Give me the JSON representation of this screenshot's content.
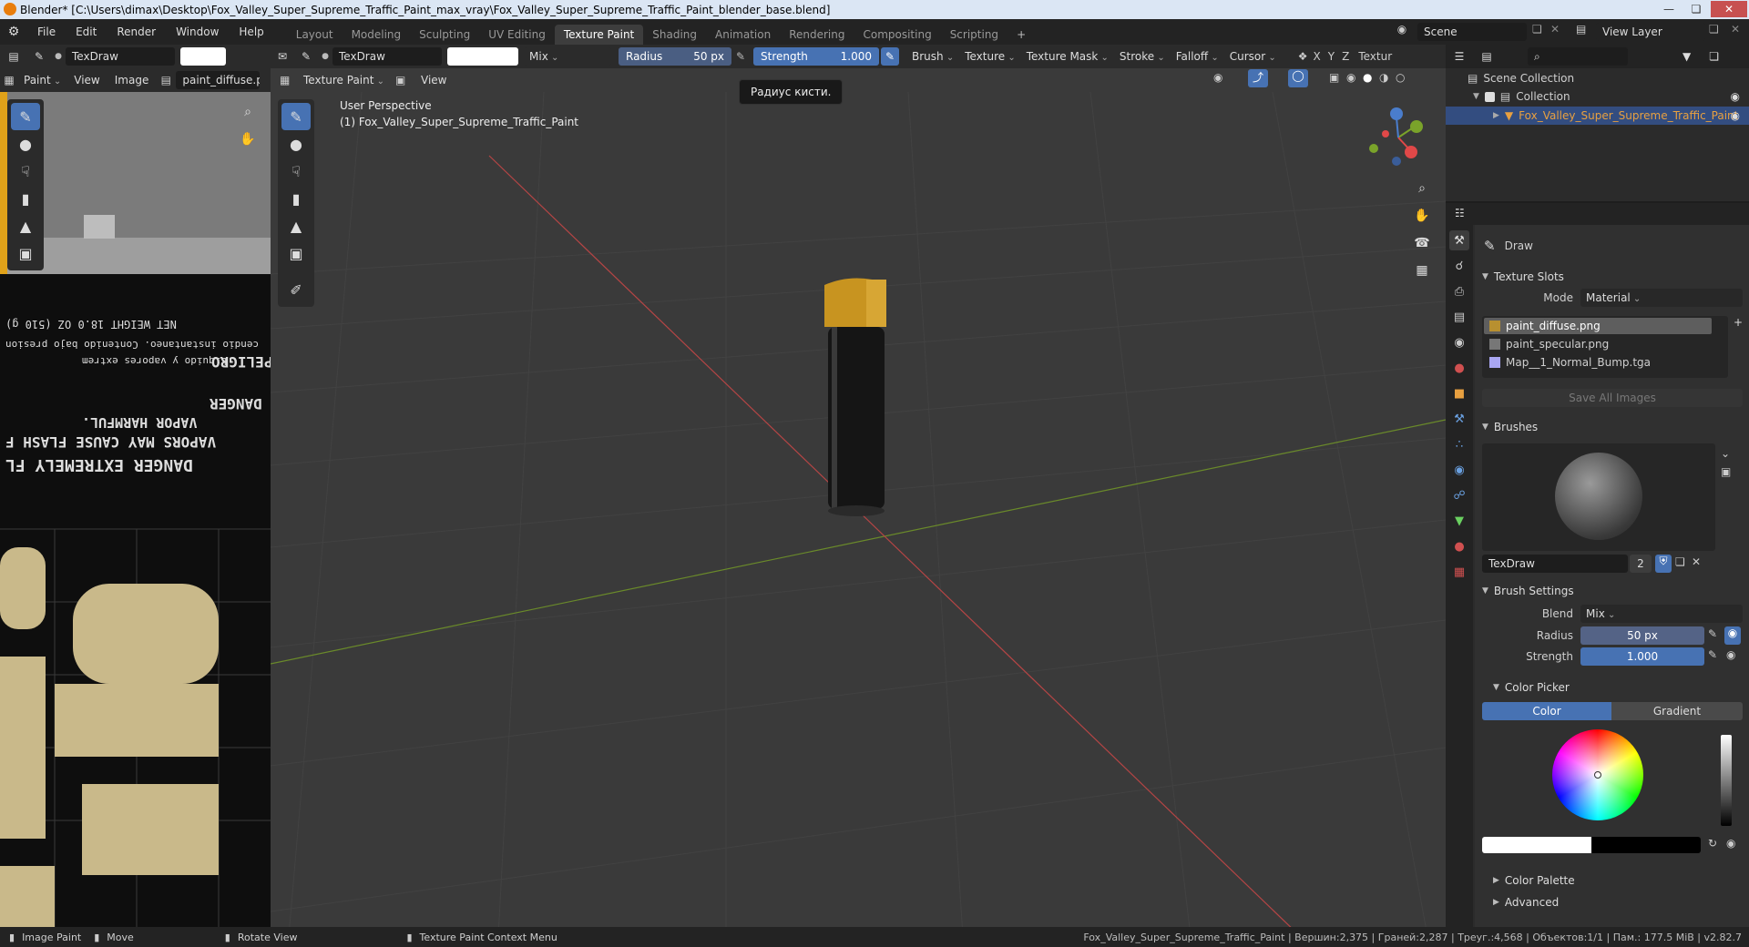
{
  "titlebar": {
    "title": "Blender* [C:\\Users\\dimax\\Desktop\\Fox_Valley_Super_Supreme_Traffic_Paint_max_vray\\Fox_Valley_Super_Supreme_Traffic_Paint_blender_base.blend]"
  },
  "menu": [
    "File",
    "Edit",
    "Render",
    "Window",
    "Help"
  ],
  "workspaces": [
    "Layout",
    "Modeling",
    "Sculpting",
    "UV Editing",
    "Texture Paint",
    "Shading",
    "Animation",
    "Rendering",
    "Compositing",
    "Scripting"
  ],
  "active_workspace": "Texture Paint",
  "scene": {
    "label": "Scene",
    "view_layer": "View Layer"
  },
  "image_editor": {
    "brush_name": "TexDraw",
    "mode": "Paint",
    "menus": [
      "View",
      "Image"
    ],
    "image_name": "paint_diffuse.pr",
    "label_texts": [
      "NET WEIGHT 18.0 OZ (510 g)",
      "DANGER  EXTREMELY FL",
      "VAPORS MAY CAUSE FLASH F",
      "VAPOR HARMFUL.",
      "DANGER",
      "PELIGRO",
      "Liquido y vapores extrem",
      "cendio instantaneo. Contenido bajo presion"
    ]
  },
  "toolbar3d": {
    "brush_name": "TexDraw",
    "blend": "Mix",
    "radius_label": "Radius",
    "radius_value": "50 px",
    "strength_label": "Strength",
    "strength_value": "1.000",
    "menus": [
      "Brush",
      "Texture",
      "Texture Mask",
      "Stroke",
      "Falloff",
      "Cursor"
    ],
    "axes": [
      "X",
      "Y",
      "Z"
    ],
    "textur_label": "Textur"
  },
  "viewport": {
    "mode": "Texture Paint",
    "view_menu": "View",
    "perspective": "User Perspective",
    "object_label": "(1) Fox_Valley_Super_Supreme_Traffic_Paint",
    "tooltip": "Радиус кисти."
  },
  "outliner": {
    "scene_collection": "Scene Collection",
    "collection": "Collection",
    "object": "Fox_Valley_Super_Supreme_Traffic_Paint"
  },
  "properties": {
    "tool_name": "Draw",
    "texture_slots": {
      "title": "Texture Slots",
      "mode_label": "Mode",
      "mode_value": "Material",
      "slots": [
        "paint_diffuse.png",
        "paint_specular.png",
        "Map__1_Normal_Bump.tga"
      ],
      "save_all": "Save All Images"
    },
    "brushes": {
      "title": "Brushes",
      "name": "TexDraw",
      "users": "2"
    },
    "brush_settings": {
      "title": "Brush Settings",
      "blend_label": "Blend",
      "blend_value": "Mix",
      "radius_label": "Radius",
      "radius_value": "50 px",
      "strength_label": "Strength",
      "strength_value": "1.000"
    },
    "color_picker": {
      "title": "Color Picker",
      "tab_color": "Color",
      "tab_gradient": "Gradient"
    },
    "color_palette": "Color Palette",
    "advanced": "Advanced"
  },
  "statusbar": {
    "items": [
      "Image Paint",
      "Move",
      "Rotate View",
      "Texture Paint Context Menu"
    ],
    "stats": "Fox_Valley_Super_Supreme_Traffic_Paint | Вершин:2,375 | Граней:2,287 | Треуг.:4,568 | Объектов:1/1 | Пам.: 177.5 MiB | v2.82.7"
  },
  "colors": {
    "accent": "#4772b3",
    "bg": "#303030",
    "orange": "#e87d0d"
  }
}
